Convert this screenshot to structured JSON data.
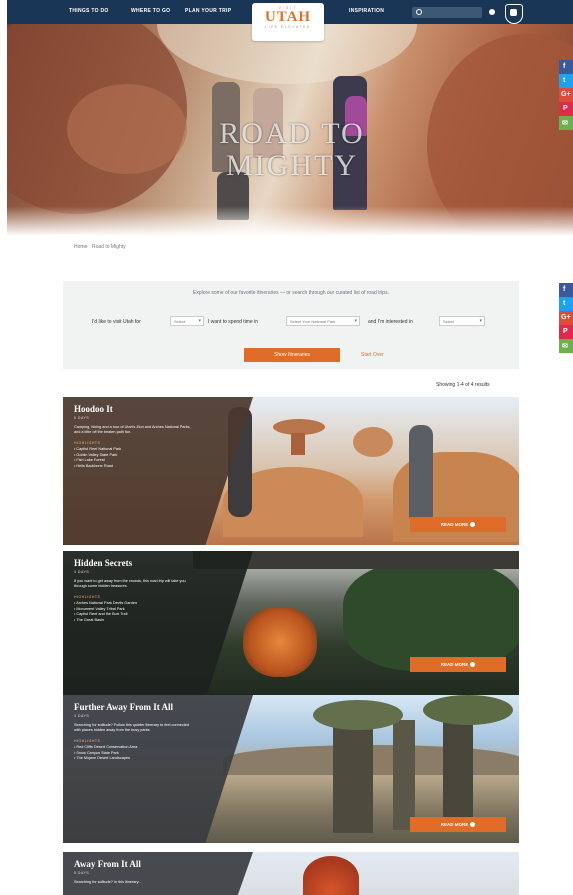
{
  "nav": {
    "links": [
      "THINGS TO DO",
      "WHERE TO GO",
      "PLAN YOUR TRIP",
      "INSPIRATION"
    ],
    "logo": {
      "top": "VISIT",
      "main": "UTAH",
      "bottom": "LIFE ELEVATED"
    }
  },
  "hero": {
    "title": "ROAD TO MIGHTY"
  },
  "social": [
    "f",
    "t",
    "G+",
    "P",
    "✉"
  ],
  "breadcrumb": [
    "Home",
    "Road to Mighty"
  ],
  "filter": {
    "intro": "Explore some of our favorite itineraries — or search through our curated list of road trips.",
    "label1": "I'd like to visit Utah for",
    "select1": "Select",
    "label2": "I want to spend time in",
    "select2": "Select Your National Park",
    "label3": "and I'm interested in",
    "select3": "Select",
    "show_button": "Show Itineraries",
    "reset": "Start Over"
  },
  "showing": "Showing 1-4 of 4 results",
  "cards": [
    {
      "title": "Hoodoo It",
      "days": "5 DAYS",
      "desc": "Camping, hiking and a tour of Utah's Zion and Arches National Parks, and a little off the beaten path fun.",
      "highlights_label": "HIGHLIGHTS",
      "items": [
        "Capitol Reef National Park",
        "Goblin Valley State Park",
        "Fish Lake Forest",
        "Hells Backbone Road"
      ],
      "button": "READ MORE"
    },
    {
      "title": "Hidden Secrets",
      "days": "4 DAYS",
      "desc": "If you want to get away from the crowds, this road trip will take you through some hidden treasures.",
      "highlights_label": "HIGHLIGHTS",
      "items": [
        "Arches National Park Devils Garden",
        "Monument Valley Tribal Park",
        "Capitol Reef and the Burr Trail",
        "The Great Basin"
      ],
      "button": "READ MORE"
    },
    {
      "title": "Further Away From It All",
      "days": "4 DAYS",
      "desc": "Searching for solitude? Follow this quieter itinerary to feel connected with places hidden away from the busy parks.",
      "highlights_label": "HIGHLIGHTS",
      "items": [
        "Red Cliffs Desert Conservation Area",
        "Snow Canyon State Park",
        "The Mojave Desert Landscapes"
      ],
      "button": "READ MORE"
    },
    {
      "title": "Away From It All",
      "days": "5 DAYS",
      "desc": "Searching for solitude? In this itinerary...",
      "highlights_label": "",
      "items": [],
      "button": ""
    }
  ],
  "colors": {
    "navy": "#1a3656",
    "orange": "#e06c2a",
    "panel_bg": "#f1f2f2"
  }
}
